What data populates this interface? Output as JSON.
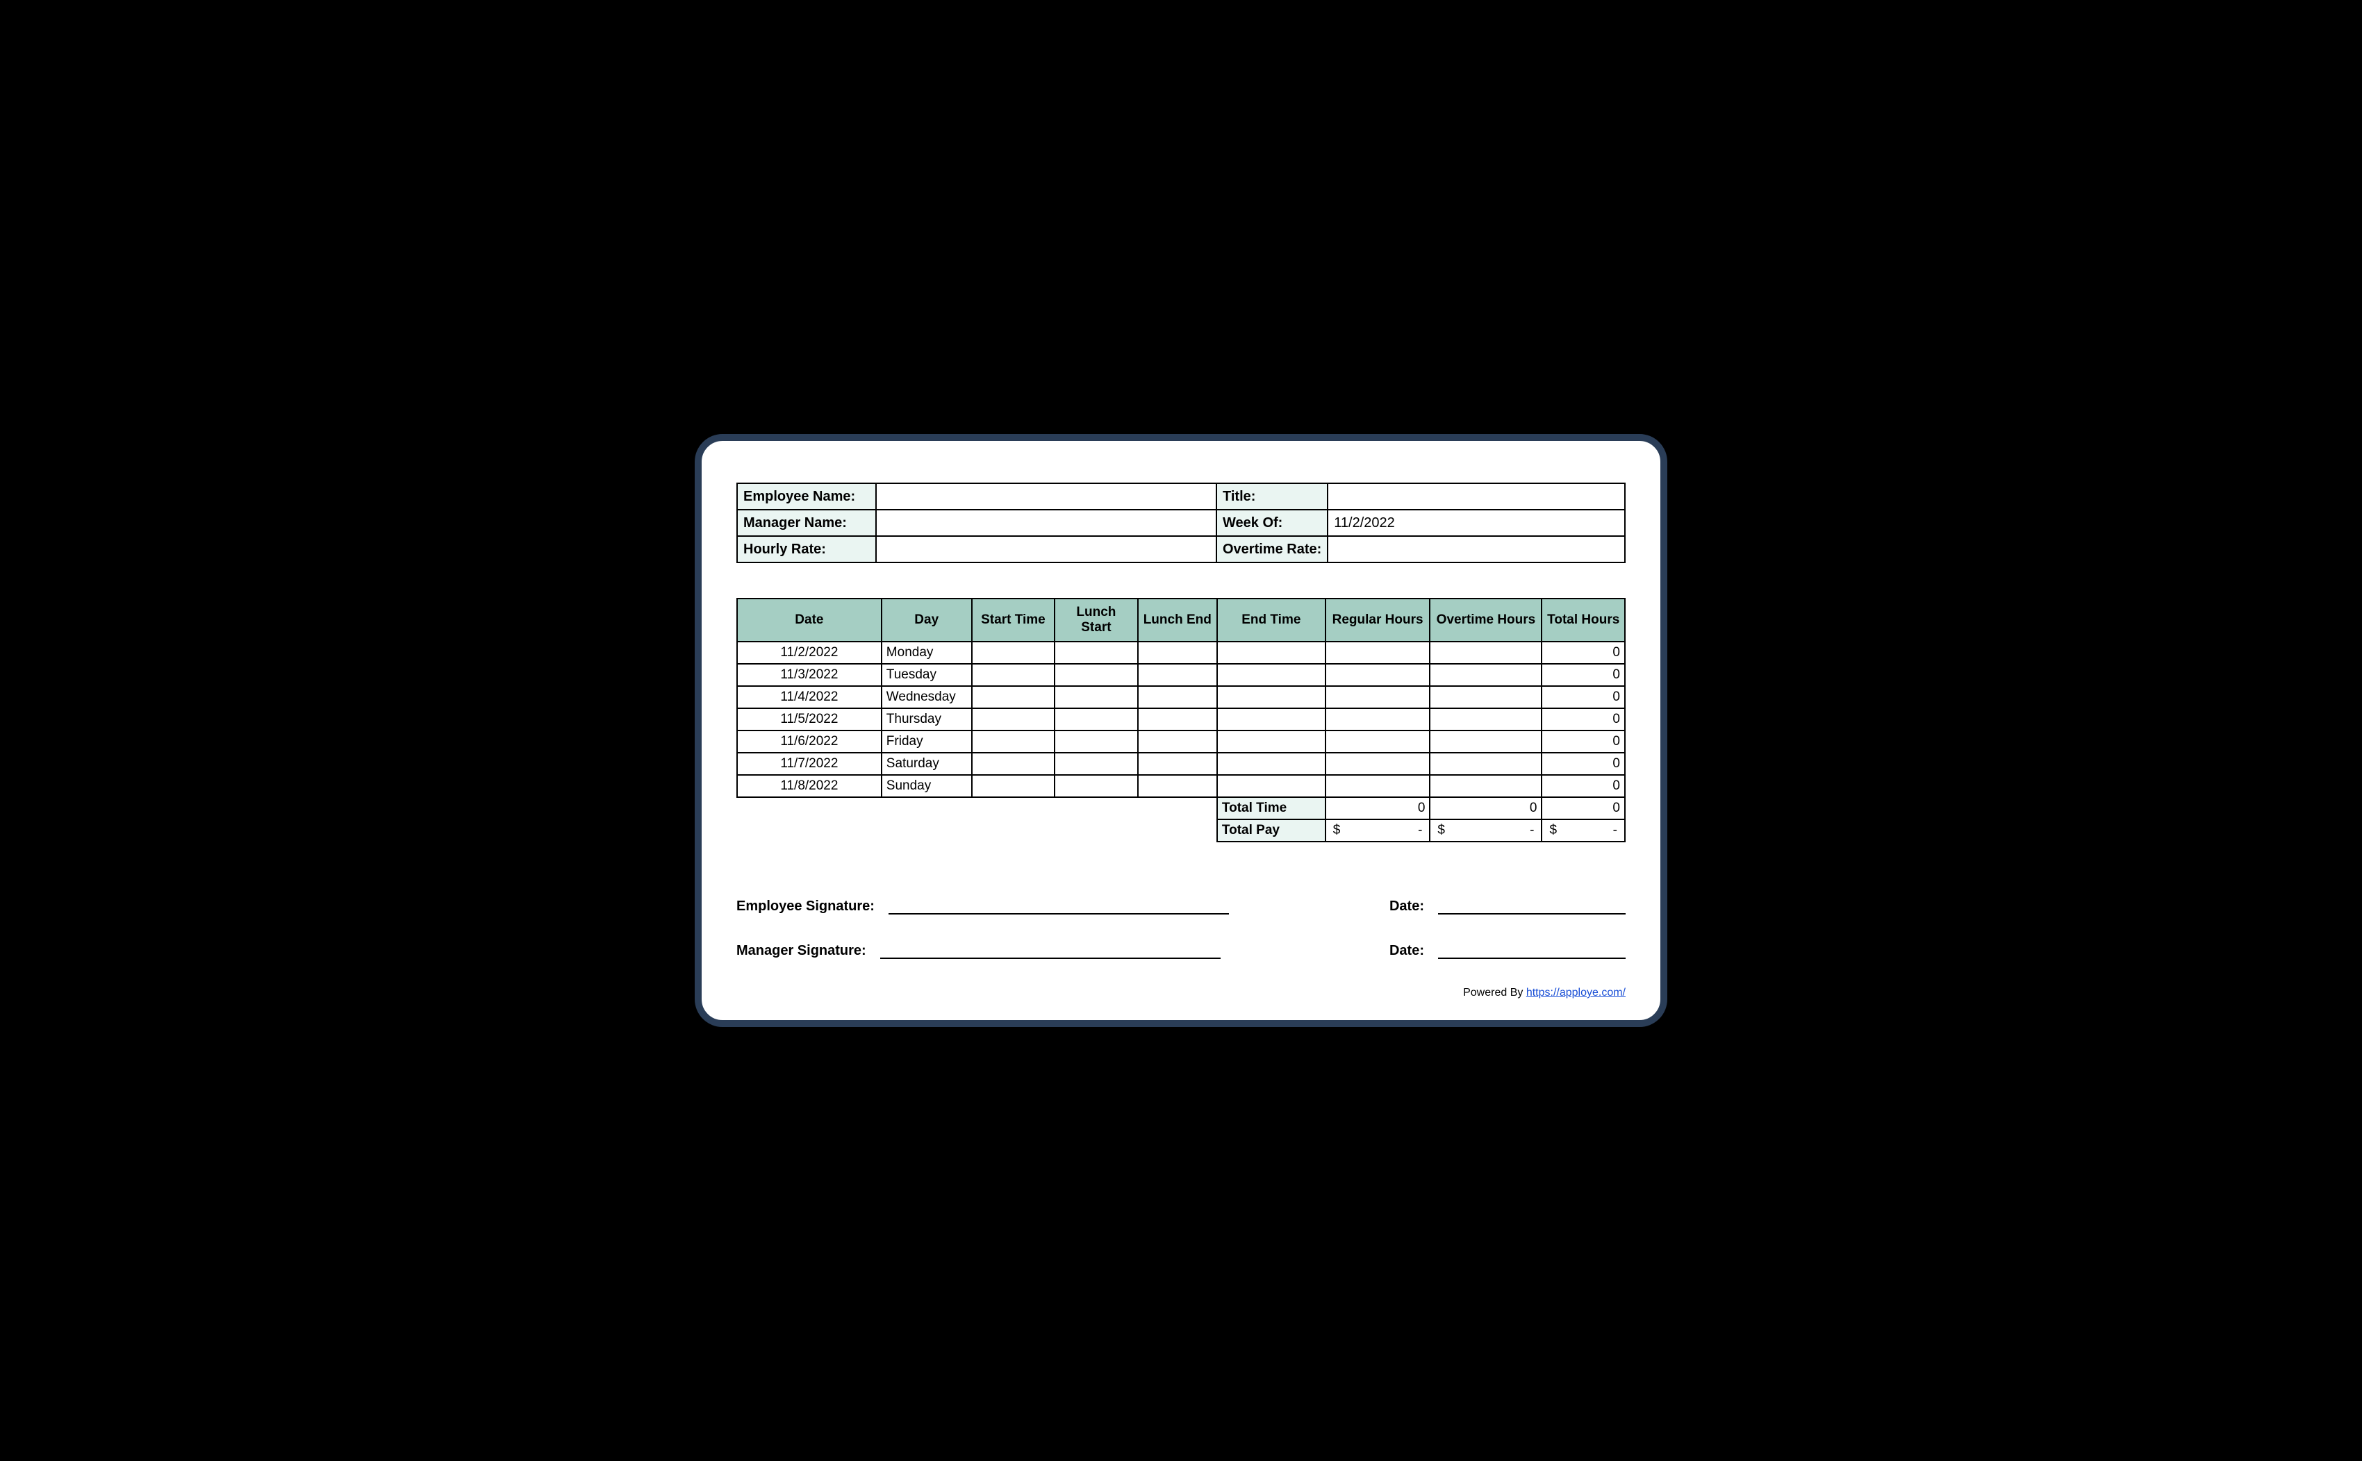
{
  "header": {
    "employee_name_label": "Employee Name:",
    "employee_name_value": "",
    "title_label": "Title:",
    "title_value": "",
    "manager_name_label": "Manager Name:",
    "manager_name_value": "",
    "week_of_label": "Week Of:",
    "week_of_value": "11/2/2022",
    "hourly_rate_label": "Hourly Rate:",
    "hourly_rate_value": "",
    "overtime_rate_label": "Overtime Rate:",
    "overtime_rate_value": ""
  },
  "columns": {
    "date": "Date",
    "day": "Day",
    "start_time": "Start Time",
    "lunch_start": "Lunch Start",
    "lunch_end": "Lunch End",
    "end_time": "End Time",
    "regular_hours": "Regular Hours",
    "overtime_hours": "Overtime Hours",
    "total_hours": "Total Hours"
  },
  "rows": [
    {
      "date": "11/2/2022",
      "day": "Monday",
      "start": "",
      "lstart": "",
      "lend": "",
      "end": "",
      "reg": "",
      "ot": "",
      "total": "0"
    },
    {
      "date": "11/3/2022",
      "day": "Tuesday",
      "start": "",
      "lstart": "",
      "lend": "",
      "end": "",
      "reg": "",
      "ot": "",
      "total": "0"
    },
    {
      "date": "11/4/2022",
      "day": "Wednesday",
      "start": "",
      "lstart": "",
      "lend": "",
      "end": "",
      "reg": "",
      "ot": "",
      "total": "0"
    },
    {
      "date": "11/5/2022",
      "day": "Thursday",
      "start": "",
      "lstart": "",
      "lend": "",
      "end": "",
      "reg": "",
      "ot": "",
      "total": "0"
    },
    {
      "date": "11/6/2022",
      "day": "Friday",
      "start": "",
      "lstart": "",
      "lend": "",
      "end": "",
      "reg": "",
      "ot": "",
      "total": "0"
    },
    {
      "date": "11/7/2022",
      "day": "Saturday",
      "start": "",
      "lstart": "",
      "lend": "",
      "end": "",
      "reg": "",
      "ot": "",
      "total": "0"
    },
    {
      "date": "11/8/2022",
      "day": "Sunday",
      "start": "",
      "lstart": "",
      "lend": "",
      "end": "",
      "reg": "",
      "ot": "",
      "total": "0"
    }
  ],
  "totals": {
    "total_time_label": "Total Time",
    "total_time_reg": "0",
    "total_time_ot": "0",
    "total_time_total": "0",
    "total_pay_label": "Total Pay",
    "currency": "$",
    "dash": "-"
  },
  "signatures": {
    "employee_sig_label": "Employee Signature:",
    "manager_sig_label": "Manager Signature:",
    "date_label": "Date:"
  },
  "footer": {
    "powered_by": "Powered By ",
    "link_text": "https://apploye.com/"
  }
}
